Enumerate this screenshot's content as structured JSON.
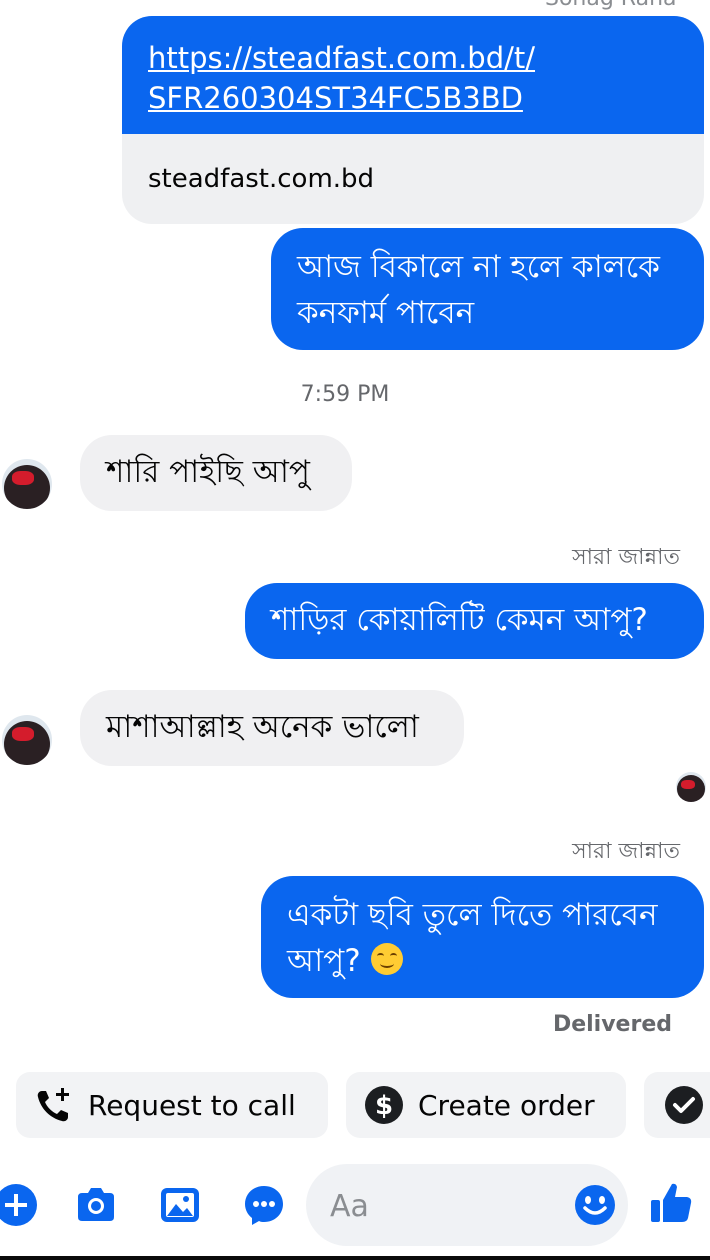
{
  "header": {
    "cutoff_name": "Sohag Rana"
  },
  "link_preview": {
    "url_line1": "https://steadfast.com.bd/t/",
    "url_line2": "SFR260304ST34FC5B3BD",
    "domain": "steadfast.com.bd"
  },
  "messages": [
    {
      "direction": "outgoing",
      "text_line1": "আজ বিকালে না হলে কালকে",
      "text_line2": "কনফার্ম পাবেন"
    },
    {
      "direction": "incoming",
      "text": "শারি পাইছি আপু"
    },
    {
      "direction": "outgoing",
      "sender": "সারা জান্নাত",
      "text": "শাড়ির কোয়ালিটি কেমন আপু?"
    },
    {
      "direction": "incoming",
      "text": "মাশাআল্লাহ অনেক ভালো"
    },
    {
      "direction": "outgoing",
      "sender": "সারা জান্নাত",
      "text_line1": "একটা ছবি তুলে দিতে পারবেন",
      "text_line2": "আপু?"
    }
  ],
  "timestamp": "7:59 PM",
  "status": "Delivered",
  "quick_actions": [
    {
      "label": "Request to call",
      "icon": "phone-plus-icon"
    },
    {
      "label": "Create order",
      "icon": "dollar-icon"
    },
    {
      "label": "",
      "icon": "check-circle-icon"
    }
  ],
  "composer": {
    "placeholder": "Aa",
    "tools": [
      "plus-icon",
      "camera-icon",
      "image-icon",
      "messenger-app-icon",
      "emoji-icon",
      "like-icon"
    ]
  },
  "colors": {
    "accent": "#0a66ef",
    "incoming_bubble": "#f0f0f2",
    "muted_text": "#65676b"
  }
}
